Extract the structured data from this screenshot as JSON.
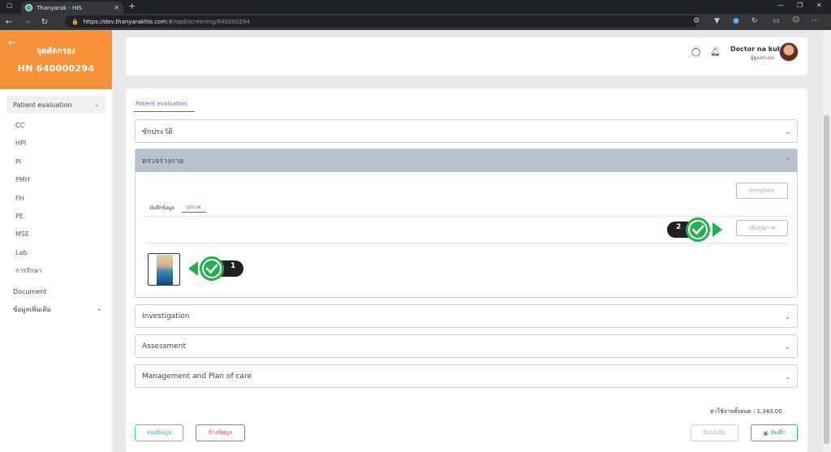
{
  "browser": {
    "tab_title": "Thanyarak - HIS",
    "url_host": "https://dev.thanyarakhis.com",
    "url_path": "/#/opd/screening/640000294"
  },
  "sidebar": {
    "title": "จุดคัดกรอง",
    "hn": "HN 640000294",
    "group_label": "Patient evaluation",
    "items": [
      "CC",
      "HPI",
      "PI",
      "PMH",
      "FH",
      "PE",
      "MSE",
      "Lab",
      "การรักษา"
    ],
    "document": "Document",
    "more": "ข้อมูลเพิ่มเติม"
  },
  "header": {
    "user_name": "Doctor na kub",
    "user_role": "ผู้ดูแลระบบ"
  },
  "main": {
    "tab_label": "Patient evaluation",
    "sections": {
      "history": "ซักประวัติ",
      "physical_exam": "ตรวจร่างกาย",
      "investigation": "Investigation",
      "assessment": "Assessment",
      "management": "Management and Plan of care"
    },
    "pe": {
      "subtab_record": "บันทึกข้อมูล",
      "subtab_image": "รูปภาพ",
      "template_button": "template",
      "add_image_button": "เพิ่มรูปภาพ",
      "marker_1": "1",
      "marker_2": "2"
    },
    "total_label": "ค่าใช้จ่ายทั้งหมด : 1,340.00",
    "buttons": {
      "summary": "สรุปข้อมูล",
      "clear": "ล้างข้อมูล",
      "back": "ย้อนกลับ",
      "save": "บันทึก"
    }
  },
  "colors": {
    "accent": "#f7923b",
    "purple": "#6b5bd6",
    "marker_green": "#22b14c"
  }
}
